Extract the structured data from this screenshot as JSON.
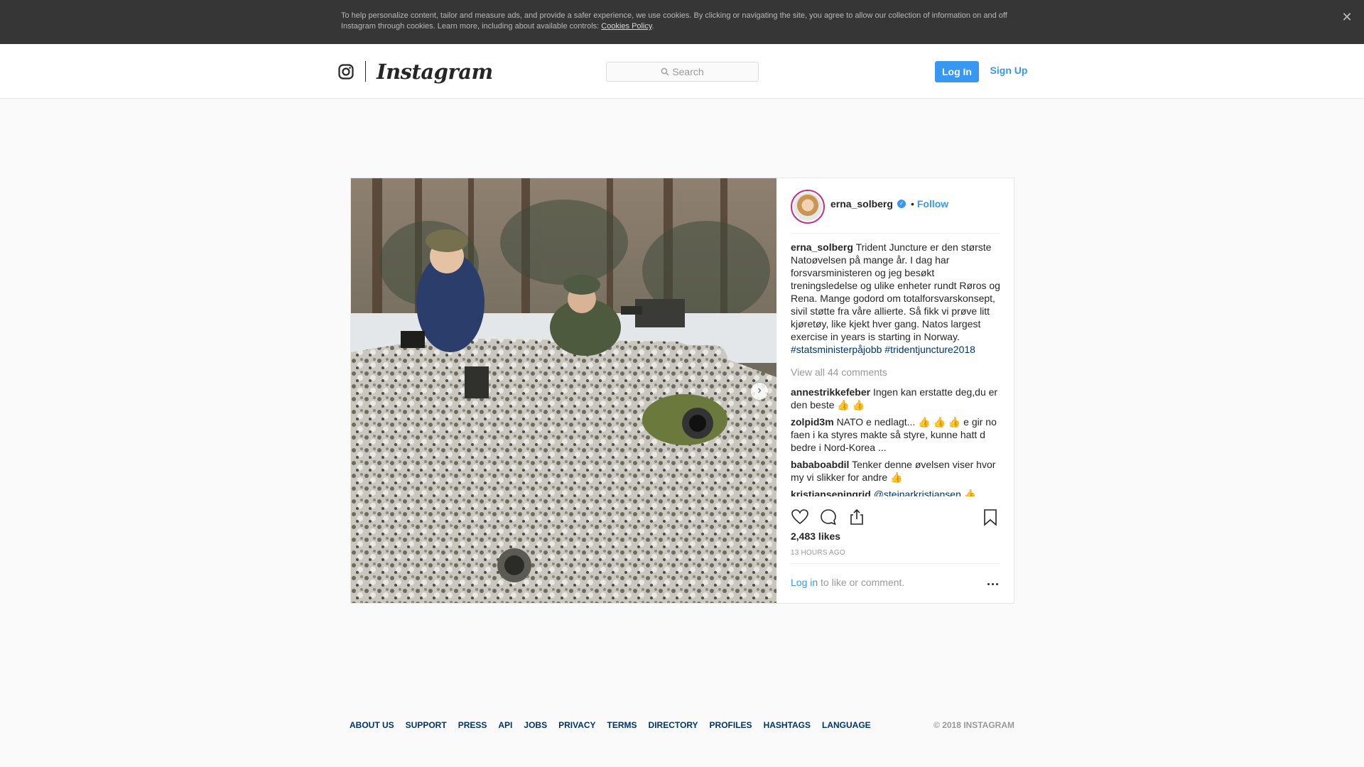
{
  "cookie_banner": {
    "text": "To help personalize content, tailor and measure ads, and provide a safer experience, we use cookies. By clicking or navigating the site, you agree to allow our collection of information on and off Instagram through cookies. Learn more, including about available controls:",
    "link": "Cookies Policy",
    "period": ".",
    "close_icon": "close-icon"
  },
  "header": {
    "logo_glyph": "instagram-glyph-icon",
    "wordmark": "Instagram",
    "search_placeholder": "Search",
    "login": "Log In",
    "signup": "Sign Up"
  },
  "post": {
    "owner": "erna_solberg",
    "separator": "•",
    "follow": "Follow",
    "caption_user": "erna_solberg",
    "caption_text": "Trident Juncture er den største Natoøvelsen på mange år. I dag har forsvarsministeren og jeg besøkt treningsledelse og ulike enheter rundt Røros og Rena. Mange godord om totalforsvarskonsept, sivil støtte fra våre allierte. Så fikk vi prøve litt kjøretøy, like kjekt hver gang. Natos largest exercise in years is starting in Norway.",
    "hashtag1": "#statsministerpåjobb",
    "hashtag2": "#tridentjuncture2018",
    "view_all": "View all 44 comments",
    "comments": [
      {
        "user": "annestrikkefeber",
        "text": "Ingen kan erstatte deg,du er den beste 👍 👍"
      },
      {
        "user": "zolpid3m",
        "text": "NATO e nedlagt... 👍 👍 👍  e gir no faen i ka styres makte så styre, kunne hatt d bedre i Nord-Korea ..."
      },
      {
        "user": "bababoabdil",
        "text": "Tenker denne øvelsen viser hvor my vi slikker for andre 👍"
      },
      {
        "user": "kristiansepingrid",
        "mention": "@steinarkristiansen",
        "text": "👍"
      }
    ],
    "likes": "2,483 likes",
    "time": "13 HOURS AGO",
    "login_link": "Log in",
    "login_rest": " to like or comment.",
    "more": "..."
  },
  "footer": {
    "links": [
      "ABOUT US",
      "SUPPORT",
      "PRESS",
      "API",
      "JOBS",
      "PRIVACY",
      "TERMS",
      "DIRECTORY",
      "PROFILES",
      "HASHTAGS",
      "LANGUAGE"
    ],
    "copyright": "© 2018 INSTAGRAM"
  }
}
